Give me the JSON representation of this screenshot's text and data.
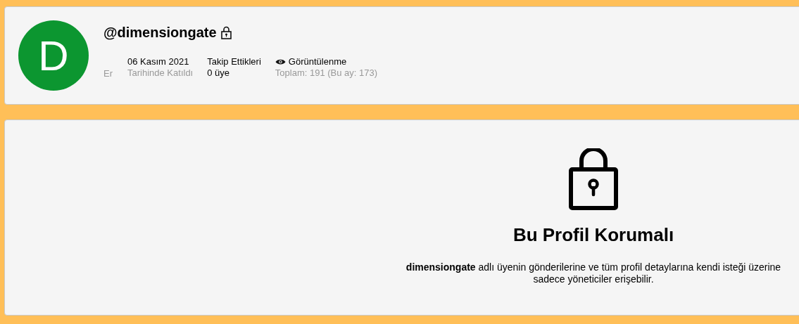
{
  "profile": {
    "avatar_letter": "D",
    "username": "@dimensiongate",
    "locked": true,
    "gender": "Er",
    "stats": [
      {
        "kind": "plain",
        "line1": "06 Kasım 2021",
        "line2": "Tarihinde Katıldı"
      },
      {
        "kind": "strong",
        "line1": "Takip Ettikleri",
        "line2": "0 üye"
      },
      {
        "kind": "views",
        "line1": "Görüntülenme",
        "line2": "Toplam: 191 (Bu ay: 173)"
      }
    ]
  },
  "notice": {
    "title": "Bu Profil Korumalı",
    "message": "**dimensiongate** adlı üyenin gönderilerine ve tüm profil detaylarına kendi isteği üzerine sadece yöneticiler erişebilir."
  }
}
